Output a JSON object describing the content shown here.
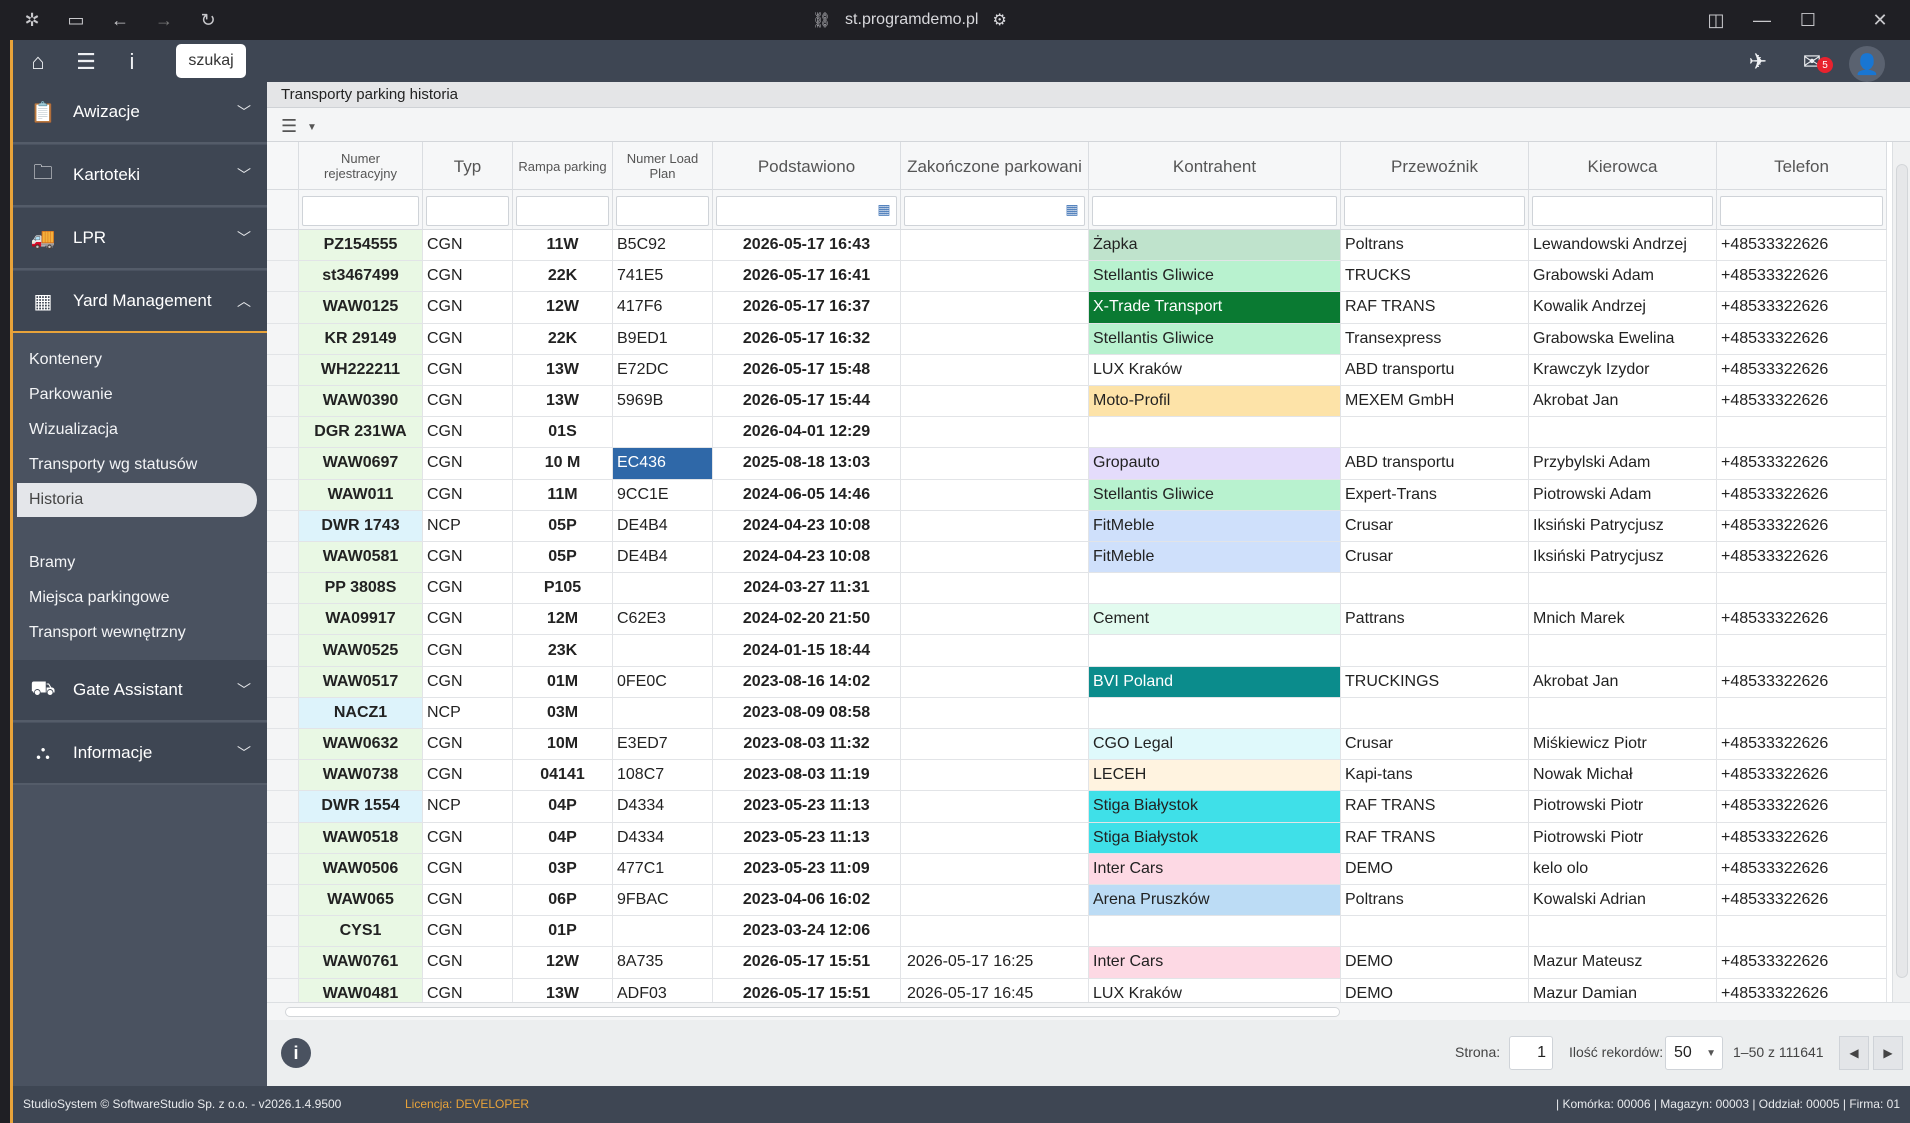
{
  "browser": {
    "url": "st.programdemo.pl"
  },
  "topbar": {
    "search_label": "szukaj",
    "mail_count": "5"
  },
  "sidebar": {
    "sections": [
      {
        "label": "Awizacje",
        "icon": "clipboard-icon"
      },
      {
        "label": "Kartoteki",
        "icon": "folder-icon"
      },
      {
        "label": "LPR",
        "icon": "truck-icon"
      },
      {
        "label": "Yard Management",
        "icon": "grid-icon"
      },
      {
        "label": "Gate Assistant",
        "icon": "gate-icon"
      },
      {
        "label": "Informacje",
        "icon": "sitemap-icon"
      }
    ],
    "yard_items": [
      "Kontenery",
      "Parkowanie",
      "Wizualizacja",
      "Transporty wg statusów",
      "Historia"
    ],
    "yard_items2": [
      "Bramy",
      "Miejsca parkingowe",
      "Transport wewnętrzny"
    ]
  },
  "panel": {
    "title": "Transporty parking historia"
  },
  "table": {
    "headers": [
      "Numer rejestracyjny",
      "Typ",
      "Rampa parking",
      "Numer Load Plan",
      "Podstawiono",
      "Zakończone parkowani",
      "Kontrahent",
      "Przewoźnik",
      "Kierowca",
      "Telefon"
    ],
    "rows": [
      [
        "PZ154555",
        "CGN",
        "11W",
        "B5C92",
        "2026-05-17 16:43",
        "",
        "Żapka",
        "Poltrans",
        "Lewandowski Andrzej",
        "+48533322626"
      ],
      [
        "st3467499",
        "CGN",
        "22K",
        "741E5",
        "2026-05-17 16:41",
        "",
        "Stellantis Gliwice",
        "TRUCKS",
        "Grabowski Adam",
        "+48533322626"
      ],
      [
        "WAW0125",
        "CGN",
        "12W",
        "417F6",
        "2026-05-17 16:37",
        "",
        "X-Trade Transport",
        "RAF TRANS",
        "Kowalik Andrzej",
        "+48533322626"
      ],
      [
        "KR 29149",
        "CGN",
        "22K",
        "B9ED1",
        "2026-05-17 16:32",
        "",
        "Stellantis Gliwice",
        "Transexpress",
        "Grabowska Ewelina",
        "+48533322626"
      ],
      [
        "WH222211",
        "CGN",
        "13W",
        "E72DC",
        "2026-05-17 15:48",
        "",
        "LUX Kraków",
        "ABD transportu",
        "Krawczyk Izydor",
        "+48533322626"
      ],
      [
        "WAW0390",
        "CGN",
        "13W",
        "5969B",
        "2026-05-17 15:44",
        "",
        "Moto-Profil",
        "MEXEM GmbH",
        "Akrobat Jan",
        "+48533322626"
      ],
      [
        "DGR 231WA",
        "CGN",
        "01S",
        "",
        "2026-04-01 12:29",
        "",
        "",
        "",
        "",
        ""
      ],
      [
        "WAW0697",
        "CGN",
        "10 M",
        "EC436",
        "2025-08-18 13:03",
        "",
        "Gropauto",
        "ABD transportu",
        "Przybylski Adam",
        "+48533322626"
      ],
      [
        "WAW011",
        "CGN",
        "11M",
        "9CC1E",
        "2024-06-05 14:46",
        "",
        "Stellantis Gliwice",
        "Expert-Trans",
        "Piotrowski Adam",
        "+48533322626"
      ],
      [
        "DWR 1743",
        "NCP",
        "05P",
        "DE4B4",
        "2024-04-23 10:08",
        "",
        "FitMeble",
        "Crusar",
        "Iksiński Patrycjusz",
        "+48533322626"
      ],
      [
        "WAW0581",
        "CGN",
        "05P",
        "DE4B4",
        "2024-04-23 10:08",
        "",
        "FitMeble",
        "Crusar",
        "Iksiński Patrycjusz",
        "+48533322626"
      ],
      [
        "PP 3808S",
        "CGN",
        "P105",
        "",
        "2024-03-27 11:31",
        "",
        "",
        "",
        "",
        ""
      ],
      [
        "WA09917",
        "CGN",
        "12M",
        "C62E3",
        "2024-02-20 21:50",
        "",
        "Cement",
        "Pattrans",
        "Mnich Marek",
        "+48533322626"
      ],
      [
        "WAW0525",
        "CGN",
        "23K",
        "",
        "2024-01-15 18:44",
        "",
        "",
        "",
        "",
        ""
      ],
      [
        "WAW0517",
        "CGN",
        "01M",
        "0FE0C",
        "2023-08-16 14:02",
        "",
        "BVI Poland",
        "TRUCKINGS",
        "Akrobat Jan",
        "+48533322626"
      ],
      [
        "NACZ1",
        "NCP",
        "03M",
        "",
        "2023-08-09 08:58",
        "",
        "",
        "",
        "",
        ""
      ],
      [
        "WAW0632",
        "CGN",
        "10M",
        "E3ED7",
        "2023-08-03 11:32",
        "",
        "CGO Legal",
        "Crusar",
        "Miśkiewicz Piotr",
        "+48533322626"
      ],
      [
        "WAW0738",
        "CGN",
        "04141",
        "108C7",
        "2023-08-03 11:19",
        "",
        "LECEH",
        "Kapi-tans",
        "Nowak Michał",
        "+48533322626"
      ],
      [
        "DWR 1554",
        "NCP",
        "04P",
        "D4334",
        "2023-05-23 11:13",
        "",
        "Stiga Białystok",
        "RAF TRANS",
        "Piotrowski Piotr",
        "+48533322626"
      ],
      [
        "WAW0518",
        "CGN",
        "04P",
        "D4334",
        "2023-05-23 11:13",
        "",
        "Stiga Białystok",
        "RAF TRANS",
        "Piotrowski Piotr",
        "+48533322626"
      ],
      [
        "WAW0506",
        "CGN",
        "03P",
        "477C1",
        "2023-05-23 11:09",
        "",
        "Inter Cars",
        "DEMO",
        "kelo olo",
        "+48533322626"
      ],
      [
        "WAW065",
        "CGN",
        "06P",
        "9FBAC",
        "2023-04-06 16:02",
        "",
        "Arena Pruszków",
        "Poltrans",
        "Kowalski Adrian",
        "+48533322626"
      ],
      [
        "CYS1",
        "CGN",
        "01P",
        "",
        "2023-03-24 12:06",
        "",
        "",
        "",
        "",
        ""
      ],
      [
        "WAW0761",
        "CGN",
        "12W",
        "8A735",
        "2026-05-17 15:51",
        "2026-05-17 16:25",
        "Inter Cars",
        "DEMO",
        "Mazur Mateusz",
        "+48533322626"
      ],
      [
        "WAW0481",
        "CGN",
        "13W",
        "ADF03",
        "2026-05-17 15:51",
        "2026-05-17 16:45",
        "LUX Kraków",
        "DEMO",
        "Mazur Damian",
        "+48533322626"
      ]
    ],
    "plate_colors": [
      "#e9f8e4",
      "#e9f8e4",
      "#e9f8e4",
      "#e9f8e4",
      "#e9f8e4",
      "#e9f8e4",
      "#e9f8e4",
      "#e9f8e4",
      "#e9f8e4",
      "#ddf3fb",
      "#e9f8e4",
      "#e9f8e4",
      "#e9f8e4",
      "#e9f8e4",
      "#e9f8e4",
      "#ddf3fb",
      "#e9f8e4",
      "#e9f8e4",
      "#ddf3fb",
      "#e9f8e4",
      "#e9f8e4",
      "#e9f8e4",
      "#e9f8e4",
      "#e9f8e4",
      "#e9f8e4"
    ],
    "contractor_colors": [
      "#bfe3cc",
      "#b8f2cf",
      "#0a7a32",
      "#b8f2cf",
      "#ffffff",
      "#fde3a8",
      "#ffffff",
      "#e4dcfb",
      "#b8f2cf",
      "#cfe0fb",
      "#cfe0fb",
      "#ffffff",
      "#e2fbef",
      "#ffffff",
      "#0b8c8c",
      "#ffffff",
      "#dff9fb",
      "#fff3e0",
      "#3fe0e8",
      "#3fe0e8",
      "#fdd9e4",
      "#bcdcf5",
      "#ffffff",
      "#fdd9e4",
      "#ffffff"
    ],
    "contractor_text_white": [
      6
    ],
    "highlight_loadplan_row": 7
  },
  "footer": {
    "page_label": "Strona:",
    "page_value": "1",
    "records_label": "Ilość rekordów:",
    "records_value": "50",
    "range": "1–50 z 111641"
  },
  "status": {
    "left": "StudioSystem © SoftwareStudio Sp. z o.o. - v2026.1.4.9500",
    "license": "Licencja: DEVELOPER",
    "right": "| Komórka: 00006 | Magazyn: 00003 | Oddział: 00005 | Firma: 01"
  }
}
